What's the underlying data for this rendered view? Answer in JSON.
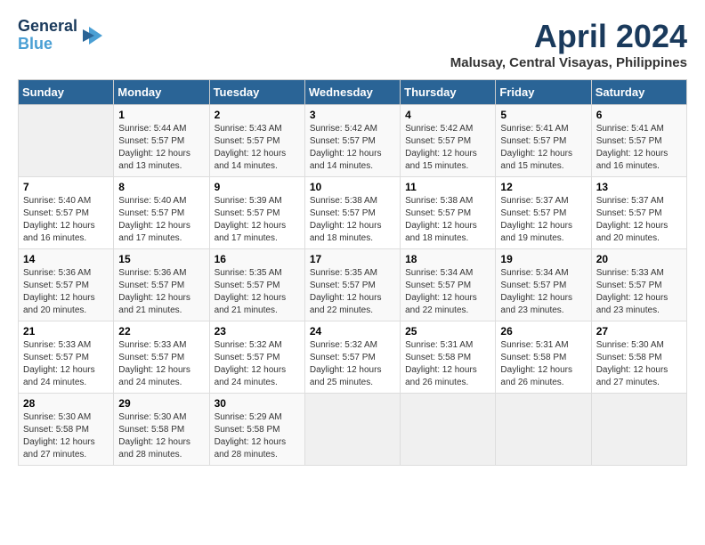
{
  "logo": {
    "line1": "General",
    "line2": "Blue"
  },
  "title": "April 2024",
  "subtitle": "Malusay, Central Visayas, Philippines",
  "days_of_week": [
    "Sunday",
    "Monday",
    "Tuesday",
    "Wednesday",
    "Thursday",
    "Friday",
    "Saturday"
  ],
  "weeks": [
    [
      {
        "day": "",
        "info": ""
      },
      {
        "day": "1",
        "info": "Sunrise: 5:44 AM\nSunset: 5:57 PM\nDaylight: 12 hours\nand 13 minutes."
      },
      {
        "day": "2",
        "info": "Sunrise: 5:43 AM\nSunset: 5:57 PM\nDaylight: 12 hours\nand 14 minutes."
      },
      {
        "day": "3",
        "info": "Sunrise: 5:42 AM\nSunset: 5:57 PM\nDaylight: 12 hours\nand 14 minutes."
      },
      {
        "day": "4",
        "info": "Sunrise: 5:42 AM\nSunset: 5:57 PM\nDaylight: 12 hours\nand 15 minutes."
      },
      {
        "day": "5",
        "info": "Sunrise: 5:41 AM\nSunset: 5:57 PM\nDaylight: 12 hours\nand 15 minutes."
      },
      {
        "day": "6",
        "info": "Sunrise: 5:41 AM\nSunset: 5:57 PM\nDaylight: 12 hours\nand 16 minutes."
      }
    ],
    [
      {
        "day": "7",
        "info": "Sunrise: 5:40 AM\nSunset: 5:57 PM\nDaylight: 12 hours\nand 16 minutes."
      },
      {
        "day": "8",
        "info": "Sunrise: 5:40 AM\nSunset: 5:57 PM\nDaylight: 12 hours\nand 17 minutes."
      },
      {
        "day": "9",
        "info": "Sunrise: 5:39 AM\nSunset: 5:57 PM\nDaylight: 12 hours\nand 17 minutes."
      },
      {
        "day": "10",
        "info": "Sunrise: 5:38 AM\nSunset: 5:57 PM\nDaylight: 12 hours\nand 18 minutes."
      },
      {
        "day": "11",
        "info": "Sunrise: 5:38 AM\nSunset: 5:57 PM\nDaylight: 12 hours\nand 18 minutes."
      },
      {
        "day": "12",
        "info": "Sunrise: 5:37 AM\nSunset: 5:57 PM\nDaylight: 12 hours\nand 19 minutes."
      },
      {
        "day": "13",
        "info": "Sunrise: 5:37 AM\nSunset: 5:57 PM\nDaylight: 12 hours\nand 20 minutes."
      }
    ],
    [
      {
        "day": "14",
        "info": "Sunrise: 5:36 AM\nSunset: 5:57 PM\nDaylight: 12 hours\nand 20 minutes."
      },
      {
        "day": "15",
        "info": "Sunrise: 5:36 AM\nSunset: 5:57 PM\nDaylight: 12 hours\nand 21 minutes."
      },
      {
        "day": "16",
        "info": "Sunrise: 5:35 AM\nSunset: 5:57 PM\nDaylight: 12 hours\nand 21 minutes."
      },
      {
        "day": "17",
        "info": "Sunrise: 5:35 AM\nSunset: 5:57 PM\nDaylight: 12 hours\nand 22 minutes."
      },
      {
        "day": "18",
        "info": "Sunrise: 5:34 AM\nSunset: 5:57 PM\nDaylight: 12 hours\nand 22 minutes."
      },
      {
        "day": "19",
        "info": "Sunrise: 5:34 AM\nSunset: 5:57 PM\nDaylight: 12 hours\nand 23 minutes."
      },
      {
        "day": "20",
        "info": "Sunrise: 5:33 AM\nSunset: 5:57 PM\nDaylight: 12 hours\nand 23 minutes."
      }
    ],
    [
      {
        "day": "21",
        "info": "Sunrise: 5:33 AM\nSunset: 5:57 PM\nDaylight: 12 hours\nand 24 minutes."
      },
      {
        "day": "22",
        "info": "Sunrise: 5:33 AM\nSunset: 5:57 PM\nDaylight: 12 hours\nand 24 minutes."
      },
      {
        "day": "23",
        "info": "Sunrise: 5:32 AM\nSunset: 5:57 PM\nDaylight: 12 hours\nand 24 minutes."
      },
      {
        "day": "24",
        "info": "Sunrise: 5:32 AM\nSunset: 5:57 PM\nDaylight: 12 hours\nand 25 minutes."
      },
      {
        "day": "25",
        "info": "Sunrise: 5:31 AM\nSunset: 5:58 PM\nDaylight: 12 hours\nand 26 minutes."
      },
      {
        "day": "26",
        "info": "Sunrise: 5:31 AM\nSunset: 5:58 PM\nDaylight: 12 hours\nand 26 minutes."
      },
      {
        "day": "27",
        "info": "Sunrise: 5:30 AM\nSunset: 5:58 PM\nDaylight: 12 hours\nand 27 minutes."
      }
    ],
    [
      {
        "day": "28",
        "info": "Sunrise: 5:30 AM\nSunset: 5:58 PM\nDaylight: 12 hours\nand 27 minutes."
      },
      {
        "day": "29",
        "info": "Sunrise: 5:30 AM\nSunset: 5:58 PM\nDaylight: 12 hours\nand 28 minutes."
      },
      {
        "day": "30",
        "info": "Sunrise: 5:29 AM\nSunset: 5:58 PM\nDaylight: 12 hours\nand 28 minutes."
      },
      {
        "day": "",
        "info": ""
      },
      {
        "day": "",
        "info": ""
      },
      {
        "day": "",
        "info": ""
      },
      {
        "day": "",
        "info": ""
      }
    ]
  ]
}
